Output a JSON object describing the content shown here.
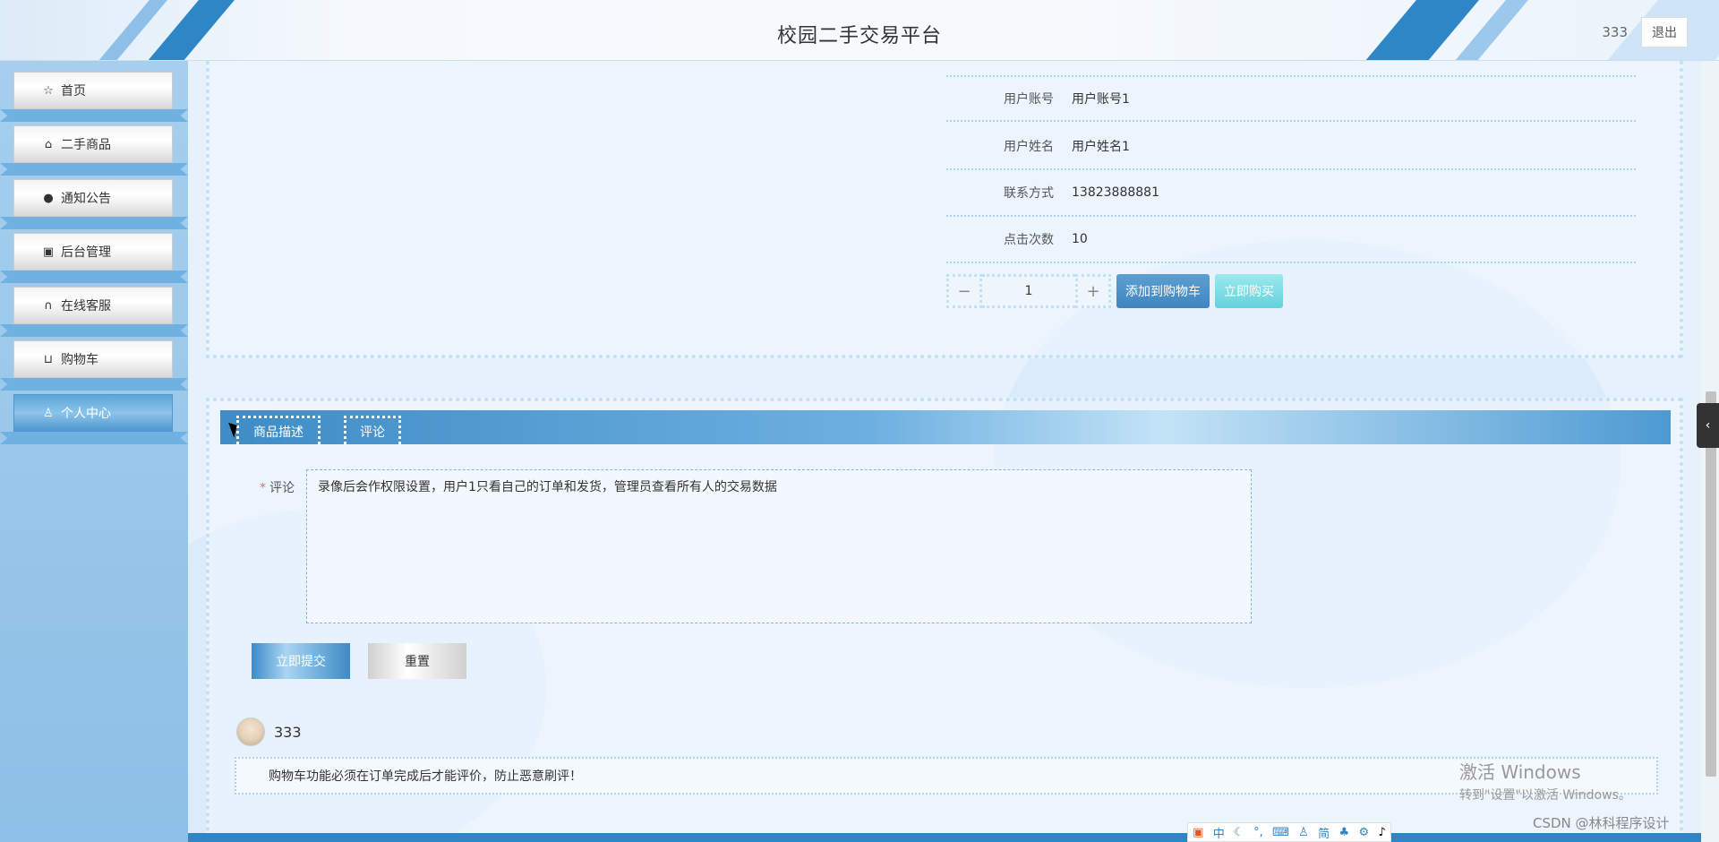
{
  "header": {
    "title": "校园二手交易平台",
    "username": "333",
    "logout_label": "退出"
  },
  "sidebar": {
    "items": [
      {
        "label": "首页",
        "icon": "star-icon"
      },
      {
        "label": "二手商品",
        "icon": "bag-icon"
      },
      {
        "label": "通知公告",
        "icon": "alert-icon"
      },
      {
        "label": "后台管理",
        "icon": "briefcase-icon"
      },
      {
        "label": "在线客服",
        "icon": "headset-icon"
      },
      {
        "label": "购物车",
        "icon": "cart-icon"
      },
      {
        "label": "个人中心",
        "icon": "user-icon"
      }
    ],
    "active_index": 6
  },
  "product_info": {
    "rows": [
      {
        "label": "用户账号",
        "value": "用户账号1"
      },
      {
        "label": "用户姓名",
        "value": "用户姓名1"
      },
      {
        "label": "联系方式",
        "value": "13823888881"
      },
      {
        "label": "点击次数",
        "value": "10"
      }
    ],
    "quantity": "1",
    "minus_symbol": "−",
    "plus_symbol": "+",
    "add_to_cart_label": "添加到购物车",
    "buy_now_label": "立即购买"
  },
  "tabs": [
    {
      "label": "商品描述"
    },
    {
      "label": "评论"
    }
  ],
  "comment_form": {
    "label": "评论",
    "required_mark": "*",
    "value": "录像后会作权限设置，用户1只看自己的订单和发货，管理员查看所有人的交易数据",
    "submit_label": "立即提交",
    "reset_label": "重置"
  },
  "comments": [
    {
      "user": "333",
      "content": "购物车功能必须在订单完成后才能评价，防止恶意刷评！"
    }
  ],
  "system": {
    "activation_title": "激活 Windows",
    "activation_sub": "转到\"设置\"以激活 Windows。",
    "watermark": "CSDN @林科程序设计",
    "ime_items": [
      "中",
      "简"
    ]
  },
  "colors": {
    "accent": "#2f86c6",
    "sidebar_bg": "#a6cfee",
    "buy_now": "#65d2db"
  }
}
